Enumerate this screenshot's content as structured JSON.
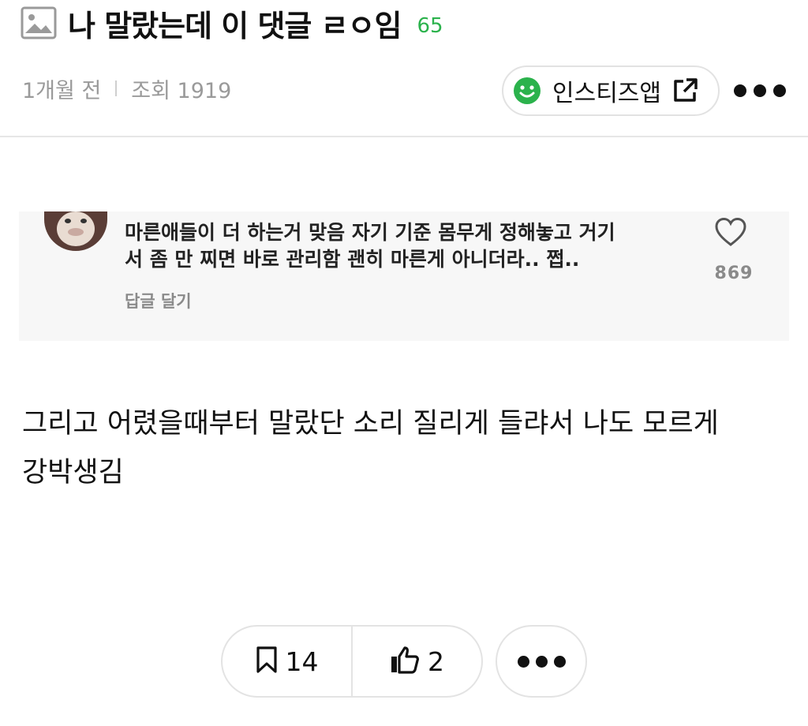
{
  "post": {
    "title": "나 말랐는데 이 댓글 ㄹㅇ임",
    "comment_count": "65",
    "time_ago": "1개월 전",
    "views": "조회 1919"
  },
  "app_link": {
    "label": "인스티즈앱",
    "icon": "smile-icon",
    "ext_icon": "external-link-icon"
  },
  "embedded_comment": {
    "text_line1": "마른애들이 더 하는거 맞음 자기 기준 몸무게 정해놓고 거기",
    "text_line2": "서 좀 만 찌면 바로 관리함 괜히 마른게 아니더라.. 쩝..",
    "reply_label": "답글 달기",
    "like_count": "869"
  },
  "body": {
    "text": "그리고 어렸을때부터 말랐단 소리 질리게 들랴서 나도 모르게 강박생김"
  },
  "actions": {
    "bookmark_count": "14",
    "like_count": "2"
  },
  "colors": {
    "accent": "#2bb24c",
    "muted": "#9a9a9a",
    "border": "#e3e3e3"
  }
}
